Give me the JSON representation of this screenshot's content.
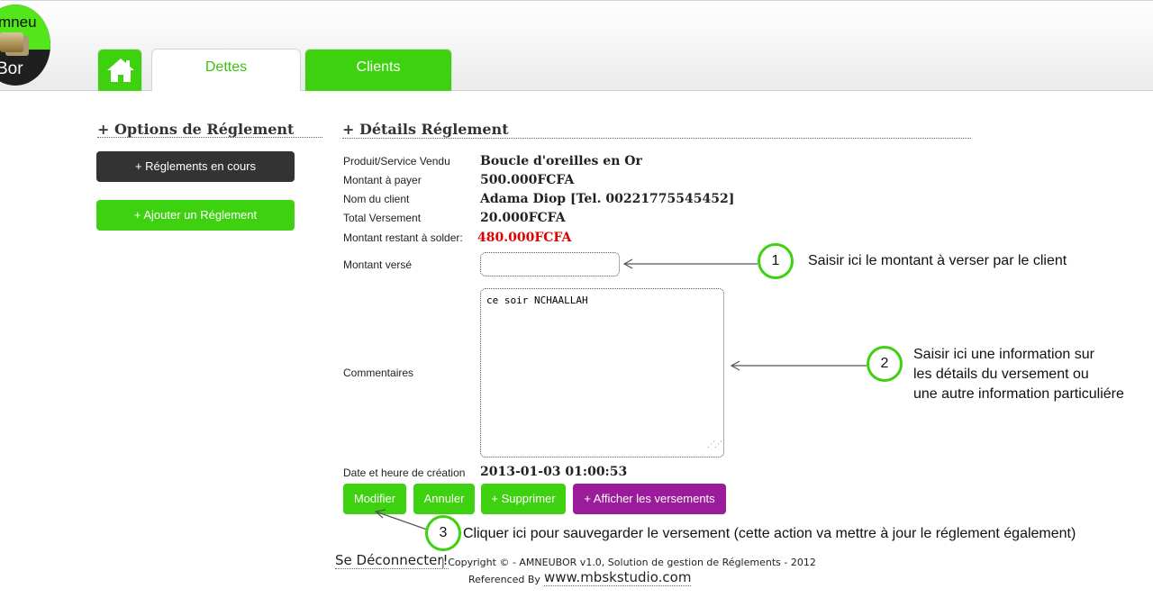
{
  "header": {
    "logo_text_top": "mneu",
    "logo_text_bottom": "Bor",
    "tabs": [
      {
        "label": "Dettes"
      },
      {
        "label": "Clients"
      }
    ]
  },
  "left_panel": {
    "title": "+ Options de Réglement",
    "buttons": [
      {
        "label": "+ Réglements en cours"
      },
      {
        "label": "+ Ajouter un Réglement"
      }
    ]
  },
  "details": {
    "title": "+ Détails Réglement",
    "rows": [
      {
        "label": "Produit/Service Vendu",
        "value": "Boucle d'oreilles en Or"
      },
      {
        "label": "Montant à payer",
        "value": "500.000FCFA"
      },
      {
        "label": "Nom du client",
        "value": "Adama Diop [Tel. 00221775545452]"
      },
      {
        "label": "Total Versement",
        "value": "20.000FCFA"
      },
      {
        "label": "Montant restant à solder:",
        "value": "480.000FCFA"
      }
    ],
    "montant_verse_label": "Montant versé",
    "montant_verse_value": "",
    "commentaires_label": "Commentaires",
    "commentaires_value": "ce soir NCHAALLAH",
    "date_label": "Date et heure de création",
    "date_value": "2013-01-03 01:00:53",
    "actions": [
      {
        "label": "Modifier"
      },
      {
        "label": "Annuler"
      },
      {
        "label": "+ Supprimer"
      },
      {
        "label": "+ Afficher les versements"
      }
    ]
  },
  "annotations": [
    {
      "number": "1",
      "lines": [
        "Saisir ici le montant à verser par le client"
      ]
    },
    {
      "number": "2",
      "lines": [
        "Saisir ici une information sur",
        "les détails du versement ou",
        "une autre information particuliére"
      ]
    },
    {
      "number": "3",
      "lines": [
        "Cliquer ici pour sauvegarder le versement (cette action va mettre à jour le réglement également)"
      ]
    }
  ],
  "footer": {
    "logout": "Se Déconnecter!",
    "copyright": "| Copyright © - AMNEUBOR v1.0, Solution de gestion de Réglements - 2012",
    "referenced_by": "Referenced By",
    "studio_link": "www.mbskstudio.com"
  },
  "colors": {
    "accent_green": "#3dd10f",
    "dark_button": "#333333",
    "purple_button": "#9a1c9a",
    "remaining_red": "#e00000"
  },
  "icons": {
    "home": "home-icon",
    "logo": "money-logo-icon"
  }
}
